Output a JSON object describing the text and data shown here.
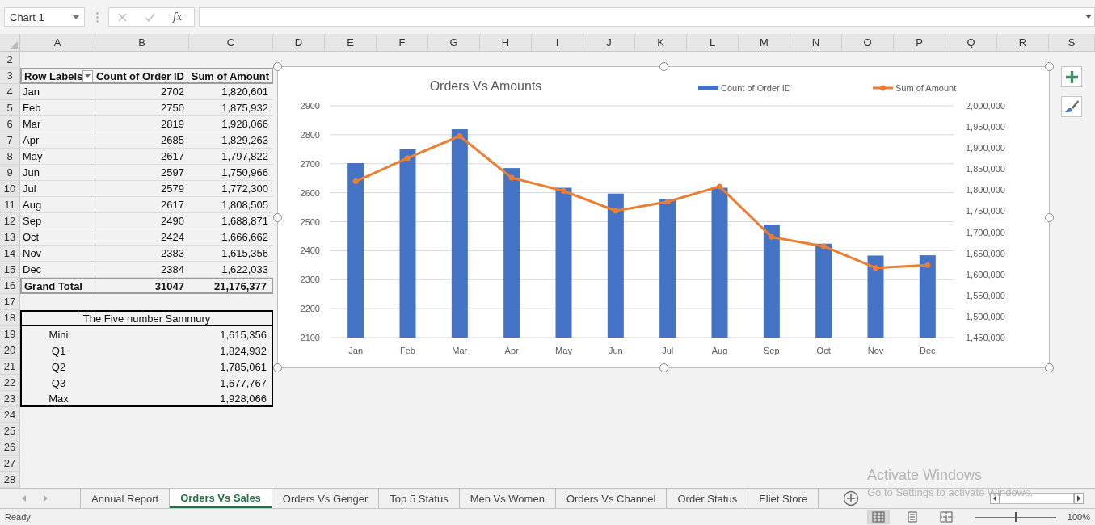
{
  "name_box": {
    "value": "Chart 1"
  },
  "formula_bar": {
    "function_label": "fx"
  },
  "columns": [
    "A",
    "B",
    "C",
    "D",
    "E",
    "F",
    "G",
    "H",
    "I",
    "J",
    "K",
    "L",
    "M",
    "N",
    "O",
    "P",
    "Q",
    "R",
    "S"
  ],
  "row_numbers": [
    "2",
    "3",
    "4",
    "5",
    "6",
    "7",
    "8",
    "9",
    "10",
    "11",
    "12",
    "13",
    "14",
    "15",
    "16",
    "17",
    "18",
    "19",
    "20",
    "21",
    "22",
    "23",
    "24",
    "25",
    "26",
    "27",
    "28"
  ],
  "pivot_table": {
    "header": [
      "Row Labels",
      "Count of Order ID",
      "Sum of Amount"
    ],
    "rows": [
      [
        "Jan",
        "2702",
        "1,820,601"
      ],
      [
        "Feb",
        "2750",
        "1,875,932"
      ],
      [
        "Mar",
        "2819",
        "1,928,066"
      ],
      [
        "Apr",
        "2685",
        "1,829,263"
      ],
      [
        "May",
        "2617",
        "1,797,822"
      ],
      [
        "Jun",
        "2597",
        "1,750,966"
      ],
      [
        "Jul",
        "2579",
        "1,772,300"
      ],
      [
        "Aug",
        "2617",
        "1,808,505"
      ],
      [
        "Sep",
        "2490",
        "1,688,871"
      ],
      [
        "Oct",
        "2424",
        "1,666,662"
      ],
      [
        "Nov",
        "2383",
        "1,615,356"
      ],
      [
        "Dec",
        "2384",
        "1,622,033"
      ]
    ],
    "total": [
      "Grand Total",
      "31047",
      "21,176,377"
    ]
  },
  "summary": {
    "title": "The Five number Sammury",
    "rows": [
      [
        "Mini",
        "1,615,356"
      ],
      [
        "Q1",
        "1,824,932"
      ],
      [
        "Q2",
        "1,785,061"
      ],
      [
        "Q3",
        "1,677,767"
      ],
      [
        "Max",
        "1,928,066"
      ]
    ]
  },
  "chart": {
    "selected": true,
    "chart_data": {
      "type": "bar",
      "title": "Orders Vs Amounts",
      "categories": [
        "Jan",
        "Feb",
        "Mar",
        "Apr",
        "May",
        "Jun",
        "Jul",
        "Aug",
        "Sep",
        "Oct",
        "Nov",
        "Dec"
      ],
      "series": [
        {
          "name": "Count of Order ID",
          "color": "#4472c4",
          "values": [
            2702,
            2750,
            2819,
            2685,
            2617,
            2597,
            2579,
            2617,
            2490,
            2424,
            2383,
            2384
          ]
        }
      ],
      "ylim": [
        2100,
        2900
      ],
      "yticks": [
        2100,
        2200,
        2300,
        2400,
        2500,
        2600,
        2700,
        2800,
        2900
      ],
      "grid": true
    }
  },
  "chart_overlay": {
    "chart_data": {
      "type": "line",
      "series": [
        {
          "name": "Sum of Amount",
          "color": "#ed7d31",
          "marker": true,
          "values": [
            1820601,
            1875932,
            1928066,
            1829263,
            1797822,
            1750966,
            1772300,
            1808505,
            1688871,
            1666662,
            1615356,
            1622033
          ]
        }
      ],
      "ylim": [
        1450000,
        2000000
      ],
      "yticks": [
        {
          "value": 1450000,
          "label": "1,450,000"
        },
        {
          "value": 1500000,
          "label": "1,500,000"
        },
        {
          "value": 1550000,
          "label": "1,550,000"
        },
        {
          "value": 1600000,
          "label": "1,600,000"
        },
        {
          "value": 1650000,
          "label": "1,650,000"
        },
        {
          "value": 1700000,
          "label": "1,700,000"
        },
        {
          "value": 1750000,
          "label": "1,750,000"
        },
        {
          "value": 1800000,
          "label": "1,800,000"
        },
        {
          "value": 1850000,
          "label": "1,850,000"
        },
        {
          "value": 1900000,
          "label": "1,900,000"
        },
        {
          "value": 1950000,
          "label": "1,950,000"
        },
        {
          "value": 2000000,
          "label": "2,000,000"
        }
      ]
    }
  },
  "sheet_tabs": [
    {
      "label": "Annual Report",
      "selected": false
    },
    {
      "label": "Orders Vs Sales",
      "selected": true
    },
    {
      "label": "Orders Vs Genger",
      "selected": false
    },
    {
      "label": "Top 5 Status",
      "selected": false
    },
    {
      "label": "Men Vs Women",
      "selected": false
    },
    {
      "label": "Orders Vs Channel",
      "selected": false
    },
    {
      "label": "Order Status",
      "selected": false
    },
    {
      "label": "Eliet Store",
      "selected": false
    }
  ],
  "activation_notice": {
    "title": "Activate Windows",
    "message": "Go to Settings to activate Windows."
  },
  "status_bar": {
    "status": "Ready",
    "views": [
      {
        "kind": "normal",
        "selected": true
      },
      {
        "kind": "page-layout",
        "selected": false
      },
      {
        "kind": "page-break",
        "selected": false
      }
    ],
    "zoom": {
      "level": 0.5,
      "reading": "100%"
    }
  }
}
